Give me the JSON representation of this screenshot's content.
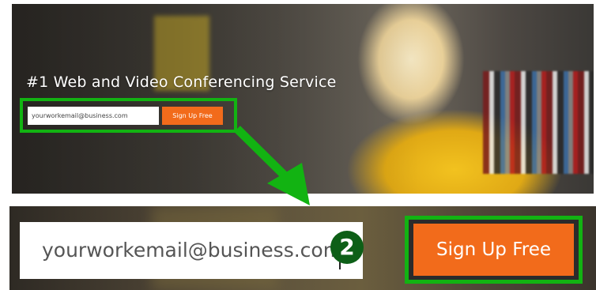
{
  "hero": {
    "title": "#1 Web and Video Conferencing Service",
    "email_value": "yourworkemail@business.com",
    "signup_label": "Sign Up Free"
  },
  "zoom": {
    "email_value": "yourworkemail@business.com",
    "signup_label": "Sign Up Free",
    "step_number": "2"
  },
  "colors": {
    "highlight": "#12b312",
    "button": "#f26b1b",
    "badge": "#0d5f17"
  },
  "icons": {
    "arrow": "green-down-right-arrow"
  }
}
